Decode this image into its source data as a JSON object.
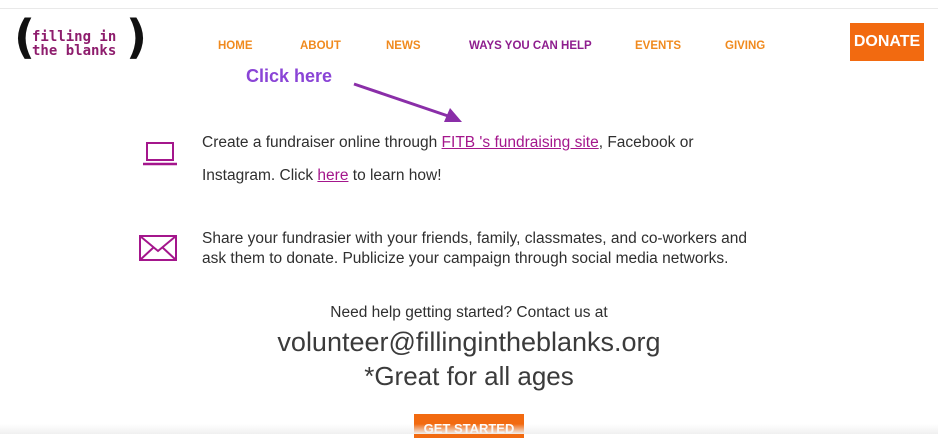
{
  "logo": {
    "line1": "filling in",
    "line2": "the blanks"
  },
  "nav": {
    "items": [
      {
        "label": "HOME"
      },
      {
        "label": "ABOUT"
      },
      {
        "label": "NEWS"
      },
      {
        "label": "WAYS YOU CAN HELP"
      },
      {
        "label": "EVENTS"
      },
      {
        "label": "GIVING"
      }
    ],
    "active": "WAYS YOU CAN HELP",
    "donate_label": "DONATE"
  },
  "annotation": {
    "text": "Click here"
  },
  "step1": {
    "icon": "laptop-icon",
    "text_before": "Create a fundraiser online through ",
    "link1": "FITB 's fundraising site",
    "text_middle": ", Facebook or",
    "line2_before": "Instagram. Click ",
    "link2": "here",
    "line2_after": " to learn how!"
  },
  "step2": {
    "icon": "envelope-icon",
    "line1": "Share your fundrasier with your friends, family, classmates, and co-workers and",
    "line2": "ask them to donate. Publicize your campaign through social media networks."
  },
  "help": {
    "prompt": "Need help getting started? Contact us at",
    "email": "volunteer@fillingintheblanks.org",
    "note": "*Great for all ages"
  },
  "cta": {
    "label": "GET STARTED"
  },
  "colors": {
    "orange": "#f26a10",
    "nav_orange": "#f08a1e",
    "purple": "#8e1d8e",
    "link": "#a4168c",
    "annotation": "#8a44d6"
  }
}
